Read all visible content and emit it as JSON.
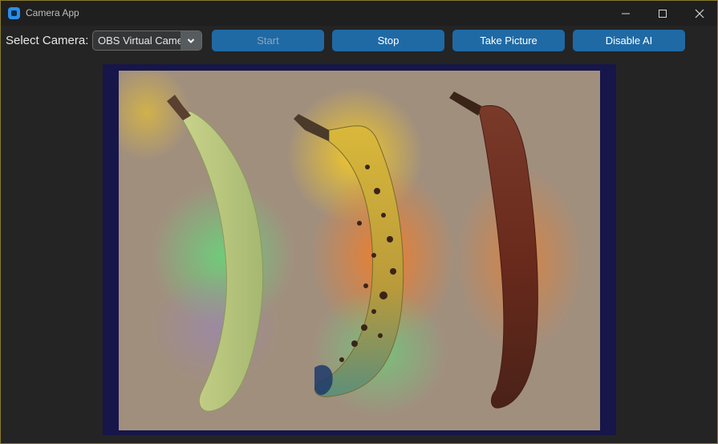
{
  "window": {
    "title": "Camera App"
  },
  "toolbar": {
    "camera_label": "Select Camera:",
    "camera_value": "OBS Virtual Camera",
    "start_label": "Start",
    "stop_label": "Stop",
    "take_picture_label": "Take Picture",
    "disable_ai_label": "Disable AI"
  },
  "colors": {
    "accent": "#1f6aa5",
    "window_bg": "#242424",
    "border": "#8a7a2e"
  },
  "icons": {
    "app": "camera-app-icon",
    "minimize": "minimize-icon",
    "maximize": "maximize-icon",
    "close": "close-icon",
    "dropdown": "chevron-down-icon"
  }
}
